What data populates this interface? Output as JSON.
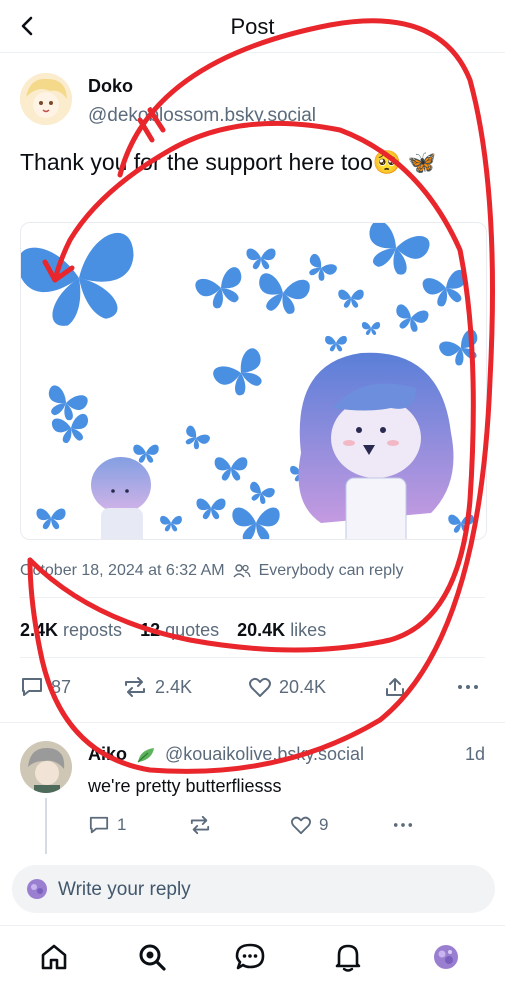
{
  "header": {
    "title": "Post"
  },
  "post": {
    "author_name": "Doko",
    "author_handle": "@dekoblossom.bsky.social",
    "text": "Thank you for the support here too🥺 🦋",
    "timestamp": "October 18, 2024 at 6:32 AM",
    "reply_setting": "Everybody can reply",
    "reposts_count": "2.4K",
    "reposts_label": "reposts",
    "quotes_count": "12",
    "quotes_label": "quotes",
    "likes_count": "20.4K",
    "likes_label": "likes",
    "actions": {
      "replies": "87",
      "reposts": "2.4K",
      "likes": "20.4K"
    }
  },
  "reply": {
    "author_name": "Aiko",
    "author_handle": "@kouaikolive.bsky.social",
    "time": "1d",
    "text": "we're pretty butterfliesss",
    "actions": {
      "replies": "1",
      "likes": "9"
    }
  },
  "composer": {
    "placeholder": "Write your reply"
  },
  "colors": {
    "accent": "#1083fe",
    "butterfly": "#4a90e2",
    "annotation": "#e8262b"
  }
}
